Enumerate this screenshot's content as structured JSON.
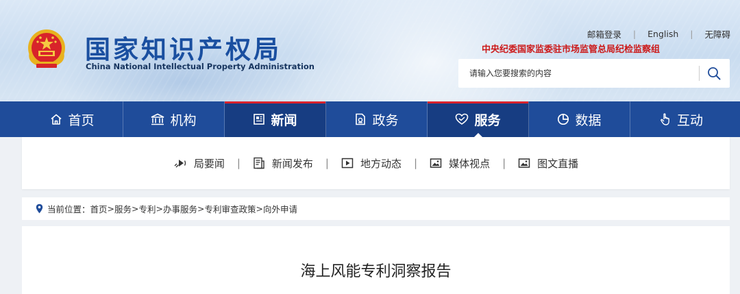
{
  "header": {
    "logo_cn": "国家知识产权局",
    "logo_en": "China National Intellectual Property Administration",
    "top_links": [
      "邮箱登录",
      "English",
      "无障碍"
    ],
    "separator": "|",
    "org_notice": "中央纪委国家监委驻市场监管总局纪检监察组",
    "search": {
      "placeholder": "请输入您要搜索的内容",
      "icon": "search-icon"
    }
  },
  "nav": {
    "items": [
      {
        "label": "首页",
        "icon": "home-icon"
      },
      {
        "label": "机构",
        "icon": "institution-icon"
      },
      {
        "label": "新闻",
        "icon": "news-icon",
        "active": true
      },
      {
        "label": "政务",
        "icon": "government-affairs-icon"
      },
      {
        "label": "服务",
        "icon": "service-heart-icon",
        "active": true
      },
      {
        "label": "数据",
        "icon": "pie-chart-icon"
      },
      {
        "label": "互动",
        "icon": "hand-pointer-icon"
      }
    ]
  },
  "subnav": {
    "items": [
      {
        "label": "局要闻",
        "icon": "broadcast-icon"
      },
      {
        "label": "新闻发布",
        "icon": "document-icon"
      },
      {
        "label": "地方动态",
        "icon": "play-icon"
      },
      {
        "label": "媒体视点",
        "icon": "image-icon"
      },
      {
        "label": "图文直播",
        "icon": "image-icon"
      }
    ],
    "separator": "|"
  },
  "breadcrumb": {
    "prefix": "当前位置：",
    "items": [
      "首页",
      "服务",
      "专利",
      "办事服务",
      "专利审查政策",
      "向外申请"
    ],
    "separator": ">"
  },
  "article": {
    "title": "海上风能专利洞察报告"
  },
  "colors": {
    "nav_bg": "#1f4c9a",
    "nav_active": "#173d82",
    "accent_red": "#d9232d",
    "logo_blue": "#1a4fa0"
  }
}
